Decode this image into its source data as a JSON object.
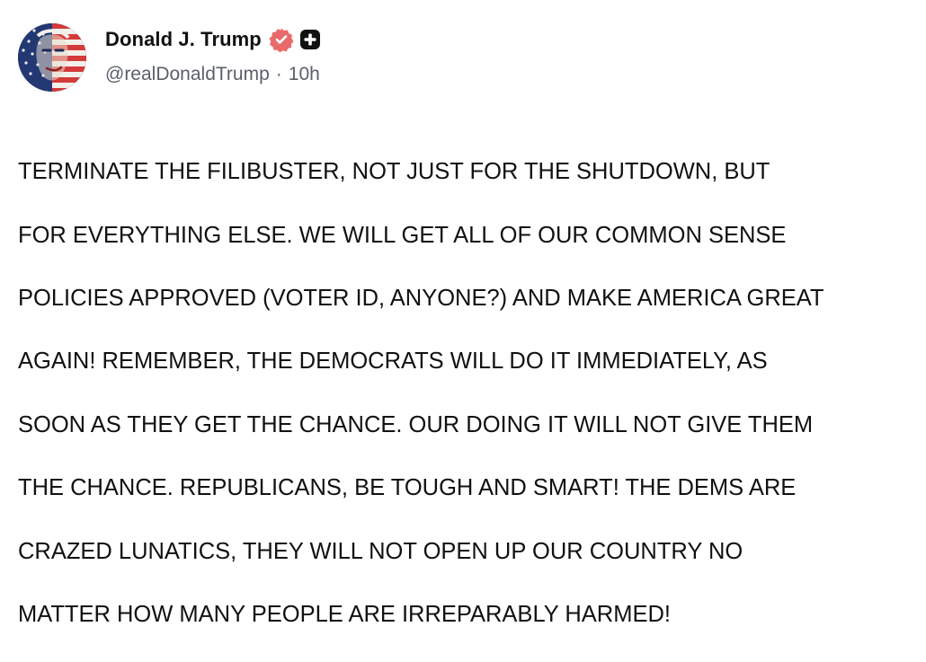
{
  "post": {
    "author": {
      "display_name": "Donald J. Trump",
      "handle": "@realDonaldTrump",
      "separator": "·",
      "time_ago": "10h",
      "verified_icon": "verified-badge-icon",
      "extra_badge_icon": "plus-badge-icon"
    },
    "body_lines": [
      "TERMINATE THE FILIBUSTER, NOT JUST FOR THE SHUTDOWN, BUT",
      "FOR EVERYTHING ELSE. WE WILL GET ALL OF OUR COMMON SENSE",
      "POLICIES APPROVED (VOTER ID, ANYONE?) AND MAKE AMERICA GREAT",
      "AGAIN! REMEMBER, THE DEMOCRATS WILL DO IT IMMEDIATELY, AS",
      "SOON AS THEY GET THE CHANCE. OUR DOING IT WILL NOT GIVE THEM",
      "THE CHANCE. REPUBLICANS, BE TOUGH AND SMART! THE DEMS ARE",
      "CRAZED LUNATICS, THEY WILL NOT OPEN UP OUR COUNTRY NO",
      "MATTER HOW MANY PEOPLE ARE IRREPARABLY HARMED!"
    ]
  },
  "colors": {
    "verified_badge": "#e96a6a",
    "plus_badge": "#111111",
    "handle_text": "#5b5f6b",
    "body_text": "#111111"
  }
}
